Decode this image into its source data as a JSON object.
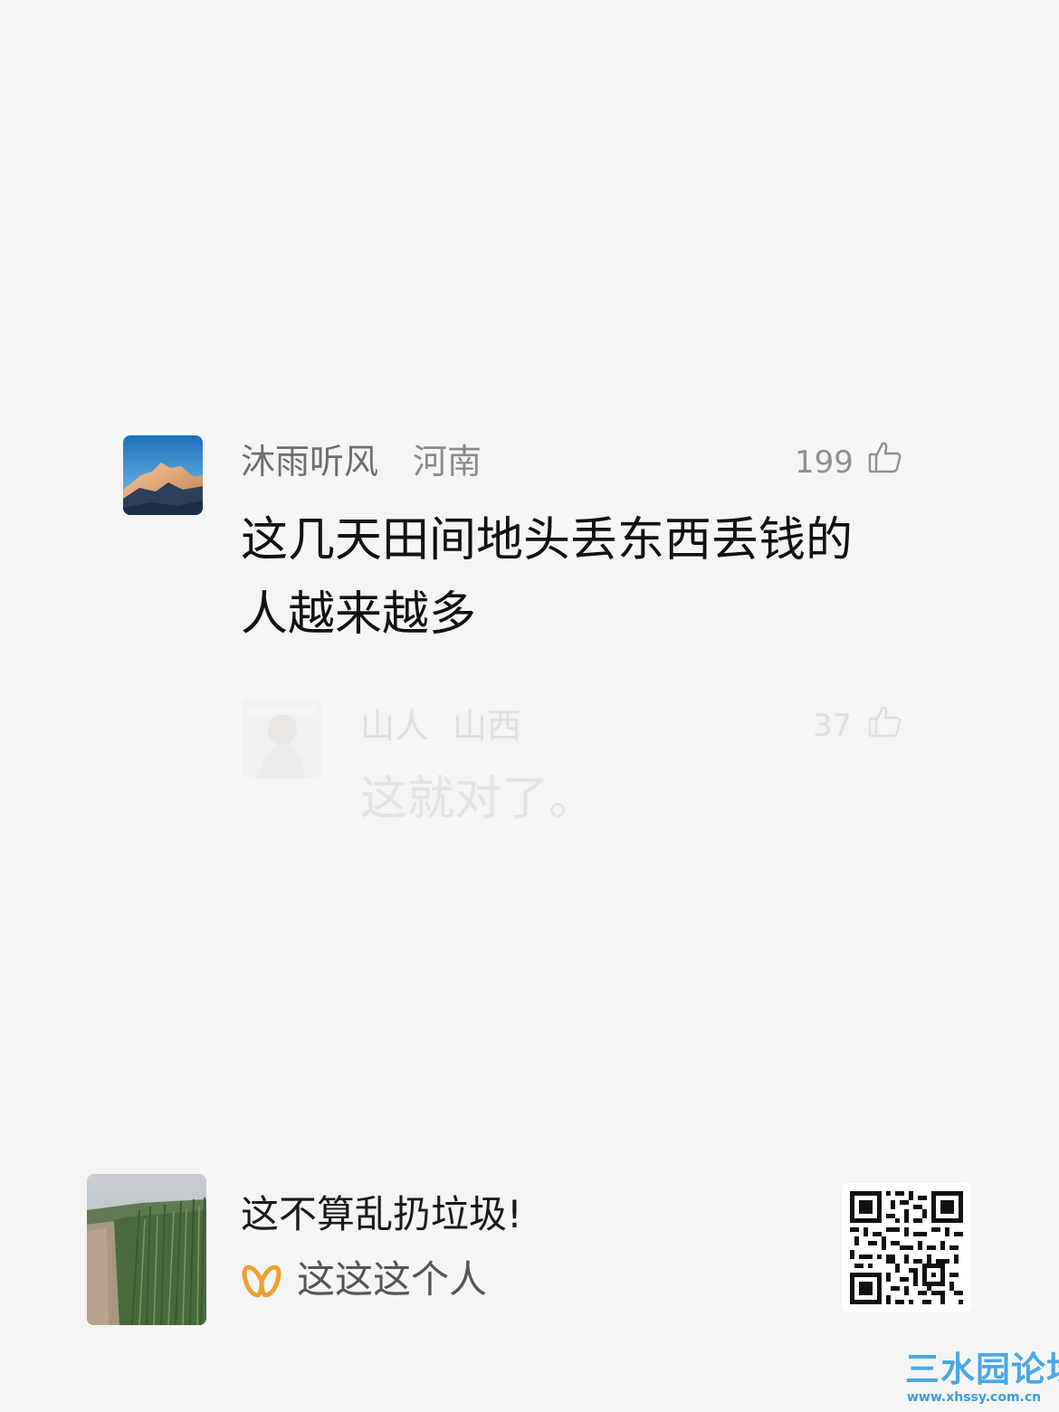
{
  "main_comment": {
    "author": "沐雨听风",
    "region": "河南",
    "likes": "199",
    "text": "这几天田间地头丢东西丢钱的人越来越多"
  },
  "reply": {
    "author": "山人",
    "region": "山西",
    "likes": "37",
    "text": "这就对了。"
  },
  "post_card": {
    "title": "这不算乱扔垃圾!",
    "author": "这这这个人"
  },
  "watermark": {
    "title": "三水园论坛",
    "url": "www.xhssy.com.cn"
  },
  "icons": {
    "like": "thumbs-up-icon",
    "brand": "butterfly-logo-icon",
    "qr": "qr-code"
  },
  "colors": {
    "background": "#f5f5f5",
    "brand_orange": "#f0a030",
    "watermark_blue": "#4aa8e6"
  }
}
